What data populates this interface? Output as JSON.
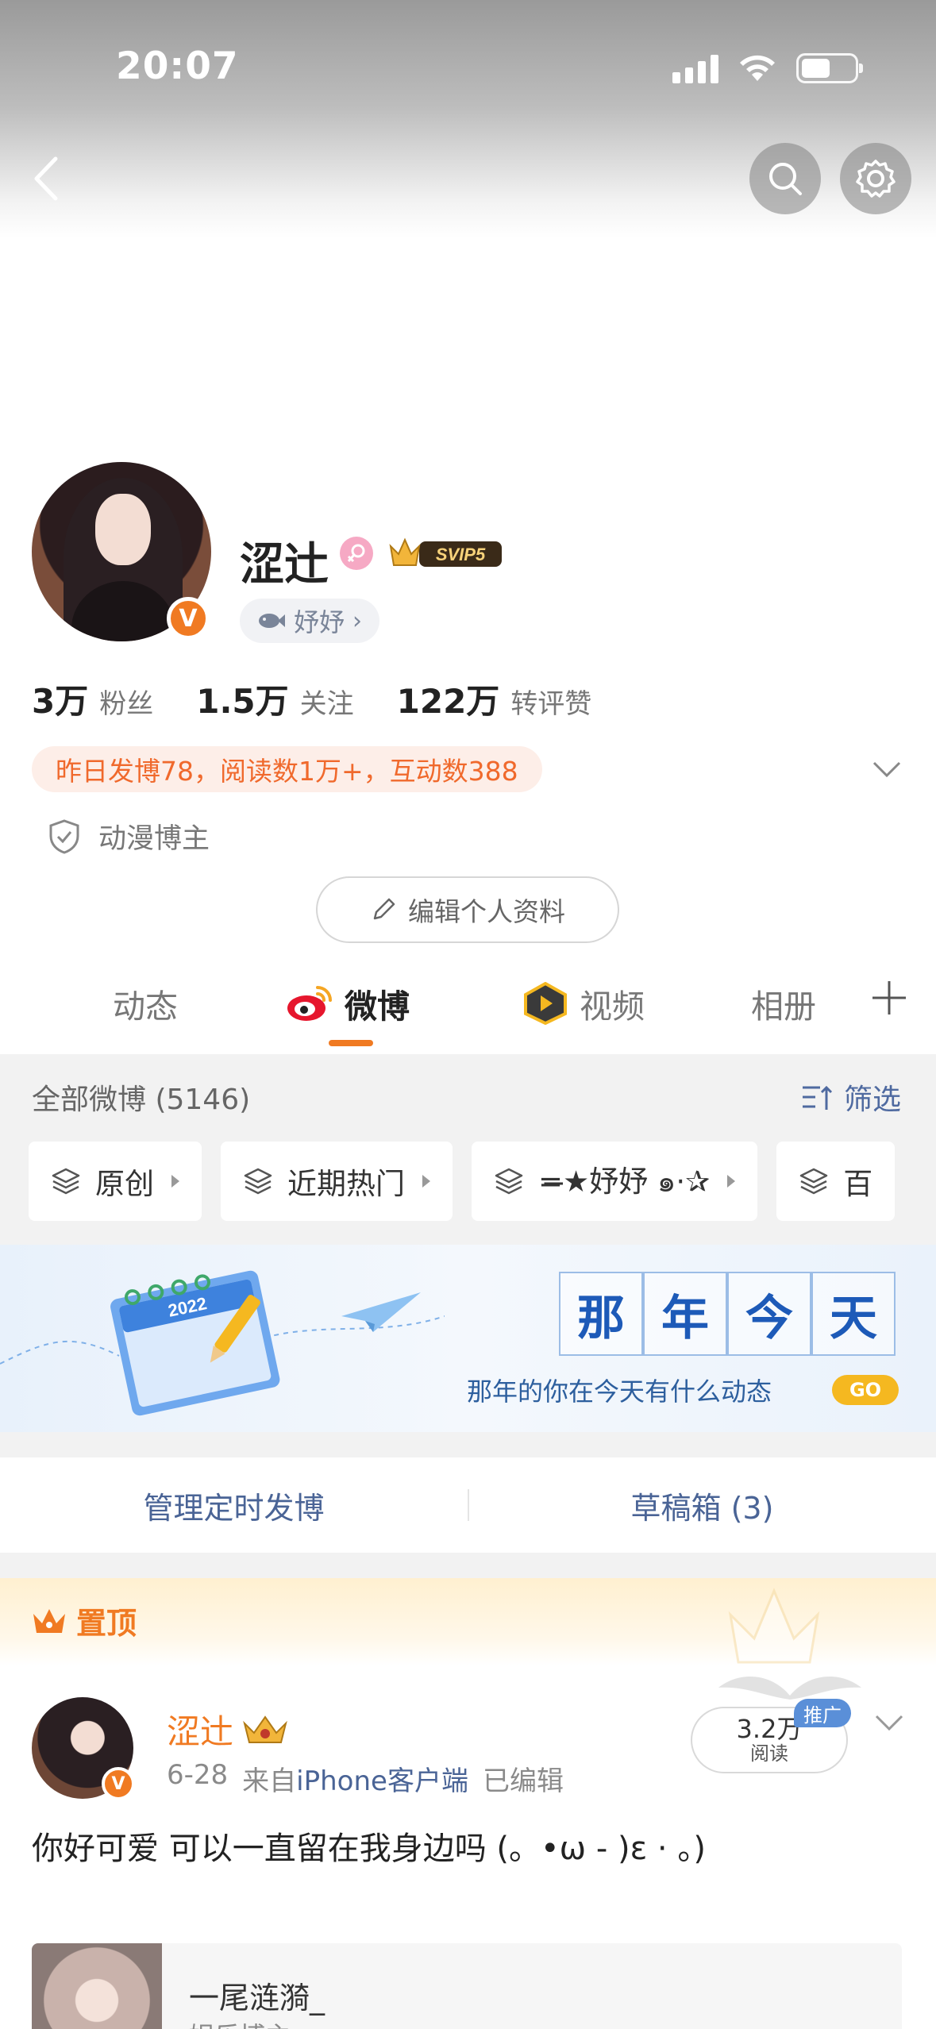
{
  "status_bar": {
    "time": "20:07"
  },
  "colors": {
    "accent": "#f07a22",
    "link": "#4a6496",
    "banner_blue": "#1d5ab8"
  },
  "nav": {
    "back_icon": "chevron-left-icon",
    "search_icon": "search-icon",
    "settings_icon": "gear-icon"
  },
  "profile": {
    "name": "涩辻",
    "vip_label": "SVIP5",
    "fanclub_label": "妤妤",
    "stats": [
      {
        "num": "3万",
        "label": "粉丝"
      },
      {
        "num": "1.5万",
        "label": "关注"
      },
      {
        "num": "122万",
        "label": "转评赞"
      }
    ],
    "notice": "昨日发博78，阅读数1万+，互动数388",
    "tag": "动漫博主",
    "edit_label": "编辑个人资料",
    "verified_mark": "V"
  },
  "tabs": [
    {
      "label": "动态"
    },
    {
      "label": "微博"
    },
    {
      "label": "视频"
    },
    {
      "label": "相册"
    }
  ],
  "feed": {
    "all_label": "全部微博 (5146)",
    "filter_label": "筛选",
    "chips": [
      {
        "label": "原创"
      },
      {
        "label": "近期热门"
      },
      {
        "label": "=̶̶★妤妤 ๑·✰"
      },
      {
        "label": "百"
      }
    ]
  },
  "banner": {
    "title_chars": [
      "那",
      "年",
      "今",
      "天"
    ],
    "subtitle": "那年的你在今天有什么动态",
    "go": "GO",
    "calendar_year": "2022"
  },
  "manage": {
    "scheduled": "管理定时发博",
    "drafts": "草稿箱 (3)"
  },
  "pinned": {
    "label": "置顶",
    "author": "涩辻",
    "date": "6-28",
    "source_prefix": "来自",
    "source": "iPhone客户端",
    "edited": "已编辑",
    "reads_num": "3.2万",
    "reads_label": "阅读",
    "ad_tag": "推广",
    "text": "你好可爱 可以一直留在我身边吗 (。•ω - )ε · 。)",
    "quote_name": "一尾涟漪_",
    "quote_sub": "娱乐博主"
  }
}
